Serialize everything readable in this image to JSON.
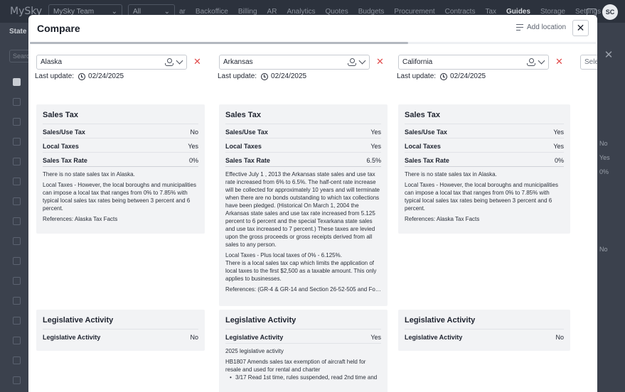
{
  "app": {
    "logo": "MySky",
    "team_select": "MySky Team",
    "all_select": "All",
    "nav": [
      "ar",
      "Backoffice",
      "Billing",
      "AR",
      "Analytics",
      "Quotes",
      "Budgets",
      "Procurement",
      "Contracts",
      "Tax",
      "Guides",
      "Storage",
      "Settings"
    ],
    "active_nav": "Guides",
    "avatar": "SC",
    "bg_tab": "State",
    "bg_search": "Search",
    "bg_right_select": "Selec",
    "bg_right_values": [
      "No",
      "Yes",
      "0%",
      "No"
    ]
  },
  "modal": {
    "title": "Compare",
    "add_location": "Add location",
    "last_update_label": "Last update:",
    "columns": [
      {
        "location": "Alaska",
        "last_update": "02/24/2025",
        "sales_tax": {
          "title": "Sales Tax",
          "rows": [
            {
              "label": "Sales/Use Tax",
              "value": "No"
            },
            {
              "label": "Local Taxes",
              "value": "Yes"
            },
            {
              "label": "Sales Tax Rate",
              "value": "0%"
            }
          ],
          "paragraphs": [
            "There is no state sales tax in Alaska.",
            "Local Taxes - However, the local boroughs and municipalities can impose a local tax that ranges from  0% to 7.85% with typical local sales tax rates being between 3 percent and 6 percent."
          ],
          "references": "References:  Alaska Tax Facts"
        },
        "legislative": {
          "title": "Legislative Activity",
          "rows": [
            {
              "label": "Legislative Activity",
              "value": "No"
            }
          ],
          "paragraphs": [],
          "bullets": []
        }
      },
      {
        "location": "Arkansas",
        "last_update": "02/24/2025",
        "sales_tax": {
          "title": "Sales Tax",
          "rows": [
            {
              "label": "Sales/Use Tax",
              "value": "Yes"
            },
            {
              "label": "Local Taxes",
              "value": "Yes"
            },
            {
              "label": "Sales Tax Rate",
              "value": "6.5%"
            }
          ],
          "paragraphs": [
            "Effective July 1 , 2013 the Arkansas state sales and use tax rate increased from 6% to 6.5%. The half-cent rate increase will be collected for approximately 10 years and will terminate when there are no bonds outstanding to which tax collections have been pledged. (Historical On March 1, 2004 the Arkansas state sales and use tax rate increased from 5.125 percent to 6 percent and the special Texarkana state sales and use tax increased to 7 percent.) These taxes are levied upon the gross proceeds or gross receipts derived from all sales to any person.",
            "Local Taxes - Plus local taxes of 0% - 6.125%.\nThere is a local sales tax cap which limits the application of local taxes to the first $2,500 as a taxable amount. This only applies to businesses."
          ],
          "references": "References:  (GR-4 & GR-14 and Section 26-52-505 and For..."
        },
        "legislative": {
          "title": "Legislative Activity",
          "rows": [
            {
              "label": "Legislative Activity",
              "value": "Yes"
            }
          ],
          "paragraphs": [
            "2025 legislative activity",
            "HB1807 Amends sales tax exemption of aircraft held for resale and used for rental and charter"
          ],
          "bullets": [
            "3/17 Read 1st time, rules suspended, read 2nd time and"
          ]
        }
      },
      {
        "location": "California",
        "last_update": "02/24/2025",
        "sales_tax": {
          "title": "Sales Tax",
          "rows": [
            {
              "label": "Sales/Use Tax",
              "value": "Yes"
            },
            {
              "label": "Local Taxes",
              "value": "Yes"
            },
            {
              "label": "Sales Tax Rate",
              "value": "0%"
            }
          ],
          "paragraphs": [
            "There is no state sales tax in Alaska.",
            "Local Taxes - However, the local boroughs and municipalities can impose a local tax that ranges from  0% to 7.85% with typical local sales tax rates being between 3 percent and 6 percent."
          ],
          "references": "References:  Alaska Tax Facts"
        },
        "legislative": {
          "title": "Legislative Activity",
          "rows": [
            {
              "label": "Legislative Activity",
              "value": "No"
            }
          ],
          "paragraphs": [],
          "bullets": []
        }
      }
    ],
    "partial_column_placeholder": "Selec"
  }
}
